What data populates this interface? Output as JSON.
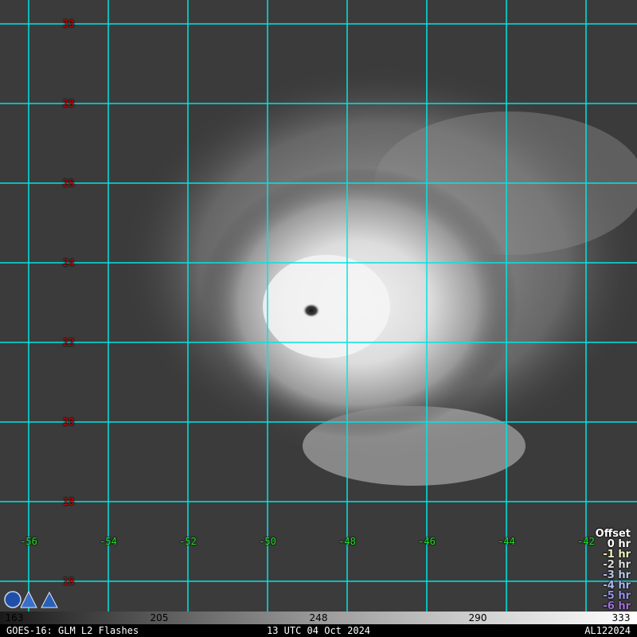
{
  "map": {
    "latitudes": [
      "30",
      "28",
      "26",
      "24",
      "22",
      "20",
      "18",
      "16"
    ],
    "longitudes": [
      "-56",
      "-54",
      "-52",
      "-50",
      "-48",
      "-46",
      "-44",
      "-42"
    ],
    "grid_color": "#00e5e5",
    "lat_label_color": "#d80000",
    "lon_label_color": "#22e022"
  },
  "legend": {
    "title": "Offset",
    "items": [
      {
        "label": "0 hr",
        "color": "#ffffff"
      },
      {
        "label": "-1 hr",
        "color": "#f2f2c0"
      },
      {
        "label": "-2 hr",
        "color": "#dcdcdc"
      },
      {
        "label": "-3 hr",
        "color": "#b8c8e8"
      },
      {
        "label": "-4 hr",
        "color": "#a8b8f0"
      },
      {
        "label": "-5 hr",
        "color": "#9890e8"
      },
      {
        "label": "-6 hr",
        "color": "#a070d8"
      }
    ]
  },
  "colorbar": {
    "ticks": [
      "163",
      "205",
      "248",
      "290",
      "333"
    ]
  },
  "footer": {
    "left": "GOES-16: GLM L2 Flashes",
    "center": "13 UTC 04 Oct 2024",
    "right": "AL122024"
  }
}
